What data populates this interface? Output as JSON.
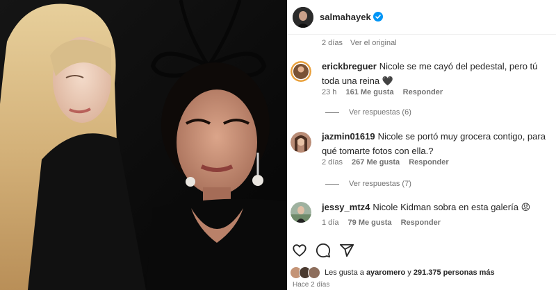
{
  "post": {
    "username": "salmahayek",
    "posted_ago": "2 días",
    "see_original": "Ver el original"
  },
  "comments": [
    {
      "username": "erickbreguer",
      "text": "Nicole se me cayó del pedestal, pero tú toda una reina 🖤",
      "time": "23 h",
      "likes": "161 Me gusta",
      "reply": "Responder",
      "view_replies": "Ver respuestas (6)"
    },
    {
      "username": "jazmin01619",
      "text": "Nicole se portó muy grocera contigo, para qué tomarte fotos con ella.?",
      "time": "2 días",
      "likes": "267 Me gusta",
      "reply": "Responder",
      "view_replies": "Ver respuestas (7)"
    },
    {
      "username": "jessy_mtz4",
      "text": "Nicole Kidman sobra en esta galería 😡",
      "time": "1 día",
      "likes": "79 Me gusta",
      "reply": "Responder"
    }
  ],
  "actions": {
    "like_icon": "heart-icon",
    "comment_icon": "comment-icon",
    "share_icon": "share-icon"
  },
  "likes_summary": {
    "prefix": "Les gusta a",
    "first_user": "ayaromero",
    "connector": "y",
    "count": "291.375 personas más"
  },
  "footer": {
    "ago": "Hace 2 días"
  },
  "colors": {
    "verified_blue": "#0095f6",
    "secondary_text": "#737373",
    "primary_text": "#262626"
  }
}
